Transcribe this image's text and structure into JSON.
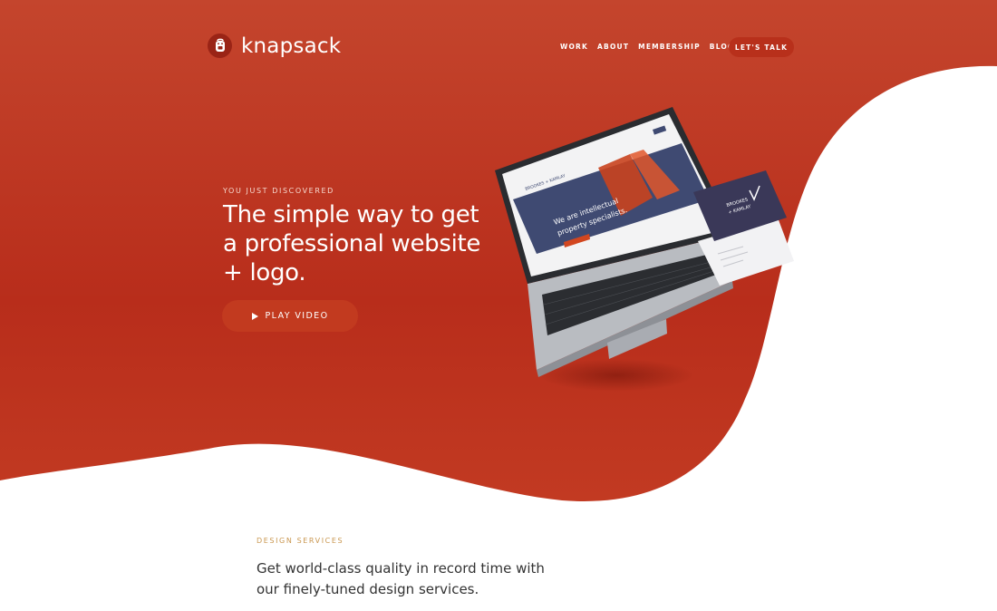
{
  "brand": {
    "name": "knapsack",
    "logo_icon": "backpack-icon"
  },
  "nav": {
    "items": [
      "WORK",
      "ABOUT",
      "MEMBERSHIP",
      "BLOG"
    ],
    "cta": "LET'S TALK"
  },
  "hero": {
    "eyebrow": "YOU JUST DISCOVERED",
    "headline": "The simple way to get a professional website + logo.",
    "play_label": "PLAY VIDEO",
    "play_icon": "play-icon"
  },
  "mockup": {
    "brand": "BROOKES + KAMLAY",
    "screen_heading_1": "We are intellectual",
    "screen_heading_2": "property specialists."
  },
  "services": {
    "eyebrow": "DESIGN SERVICES",
    "text": "Get world-class quality in record time with our finely-tuned design services."
  },
  "colors": {
    "hero_red": "#bf3b22",
    "accent_gold": "#c9964e",
    "button_red": "#c23a1f",
    "card_navy": "#3a3858"
  }
}
